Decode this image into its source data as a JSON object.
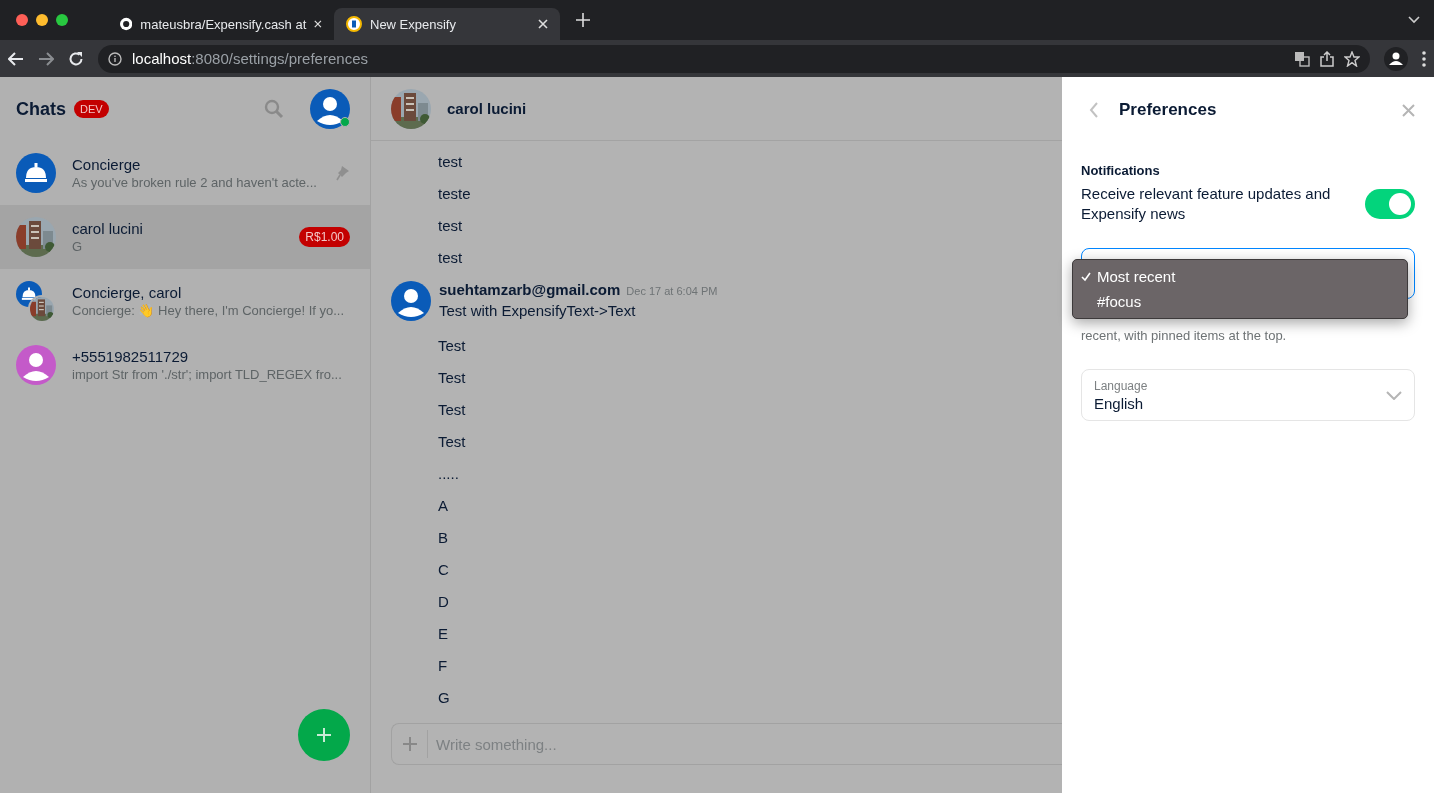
{
  "browser": {
    "tabs": [
      {
        "title": "mateusbra/Expensify.cash at",
        "kind": "github",
        "selected": false
      },
      {
        "title": "New Expensify",
        "kind": "expensify",
        "selected": true
      }
    ],
    "url_host": "localhost",
    "url_path": ":8080/settings/preferences"
  },
  "sidebar": {
    "title": "Chats",
    "badge": "DEV",
    "chats": [
      {
        "name": "Concierge",
        "preview": "As you've broken rule 2 and haven't acte...",
        "kind": "concierge",
        "pinned": true,
        "selected": false
      },
      {
        "name": "carol lucini",
        "preview": "G",
        "kind": "picture",
        "amount": "R$1.00",
        "pinned": false,
        "selected": true
      },
      {
        "name": "Concierge, carol",
        "preview": "Concierge: 👋 Hey there, I'm Concierge! If yo...",
        "kind": "group",
        "pinned": false,
        "selected": false
      },
      {
        "name": "+5551982511729",
        "preview": "import Str from './str'; import TLD_REGEX fro...",
        "kind": "person",
        "pinned": false,
        "selected": false
      }
    ]
  },
  "chat": {
    "title": "carol lucini",
    "messages": [
      {
        "text": "test"
      },
      {
        "text": "teste"
      },
      {
        "text": "test"
      },
      {
        "text": "test"
      },
      {
        "sender": "suehtamzarb@gmail.com",
        "time": "Dec 17 at 6:04 PM",
        "text": "Test with ExpensifyText->Text"
      },
      {
        "text": "Test"
      },
      {
        "text": "Test"
      },
      {
        "text": "Test"
      },
      {
        "text": "Test"
      },
      {
        "text": "....."
      },
      {
        "text": "A"
      },
      {
        "text": "B"
      },
      {
        "text": "C"
      },
      {
        "text": "D"
      },
      {
        "text": "E"
      },
      {
        "text": "F"
      },
      {
        "text": "G"
      }
    ],
    "compose_placeholder": "Write something..."
  },
  "preferences": {
    "title": "Preferences",
    "notifications_heading": "Notifications",
    "notifications_label": "Receive relevant feature updates and Expensify news",
    "notifications_on": true,
    "priority_options": [
      {
        "label": "Most recent",
        "selected": true
      },
      {
        "label": "#focus",
        "selected": false
      }
    ],
    "priority_hint": "recent, with pinned items at the top.",
    "language_label": "Language",
    "language_value": "English"
  }
}
